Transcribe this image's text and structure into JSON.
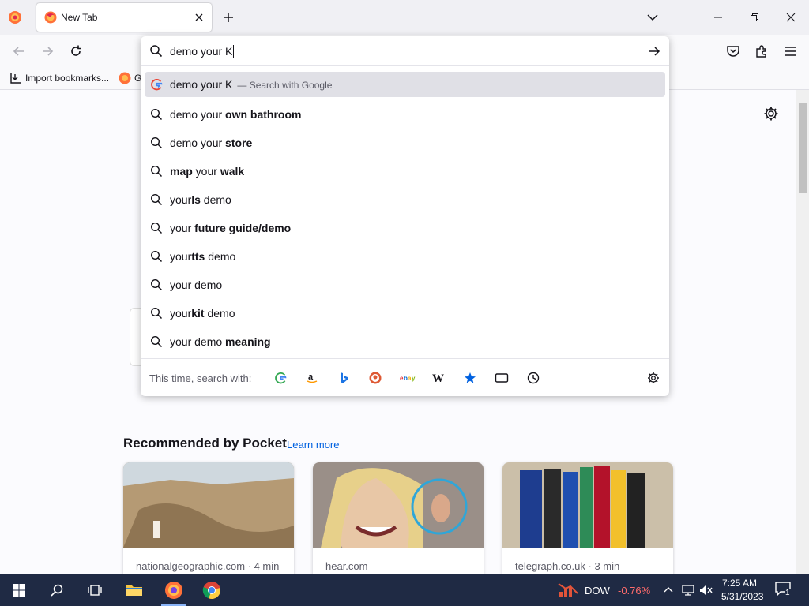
{
  "tab": {
    "title": "New Tab"
  },
  "bookmarks": [
    {
      "label": "Import bookmarks..."
    },
    {
      "label": "G"
    }
  ],
  "urlbar": {
    "value": "demo your K",
    "suggestions": [
      {
        "type": "search-engine",
        "pre": "demo your K",
        "bold": "",
        "post": "",
        "action": "— Search with Google"
      },
      {
        "pre": "demo your ",
        "bold": "own bathroom",
        "post": ""
      },
      {
        "pre": "demo your ",
        "bold": "store",
        "post": ""
      },
      {
        "pre": "",
        "bold": "map",
        "mid": " your ",
        "bold2": "walk"
      },
      {
        "pre": "your",
        "bold": "ls",
        "post": " demo"
      },
      {
        "pre": "your ",
        "bold": "future guide/demo",
        "post": ""
      },
      {
        "pre": "your",
        "bold": "tts",
        "post": " demo"
      },
      {
        "pre": "your demo",
        "bold": "",
        "post": ""
      },
      {
        "pre": "your",
        "bold": "kit",
        "post": " demo"
      },
      {
        "pre": "your demo ",
        "bold": "meaning",
        "post": ""
      }
    ],
    "one_off_label": "This time, search with:",
    "engines": [
      "google",
      "amazon",
      "bing",
      "duckduckgo",
      "ebay",
      "wikipedia",
      "bookmarks",
      "tabs",
      "history"
    ]
  },
  "pocket": {
    "title": "Recommended by Pocket",
    "learn_more": "Learn more",
    "cards": [
      {
        "source": "nationalgeographic.com · 4 min"
      },
      {
        "source": "hear.com"
      },
      {
        "source": "telegraph.co.uk · 3 min"
      }
    ]
  },
  "taskbar": {
    "stock_name": "DOW",
    "stock_change": "-0.76%",
    "time": "7:25 AM",
    "date": "5/31/2023",
    "notif_count": "1"
  },
  "colors": {
    "accent": "#0061e0",
    "stock_negative": "#ff6b6b",
    "taskbar_bg": "#1f2a44"
  }
}
